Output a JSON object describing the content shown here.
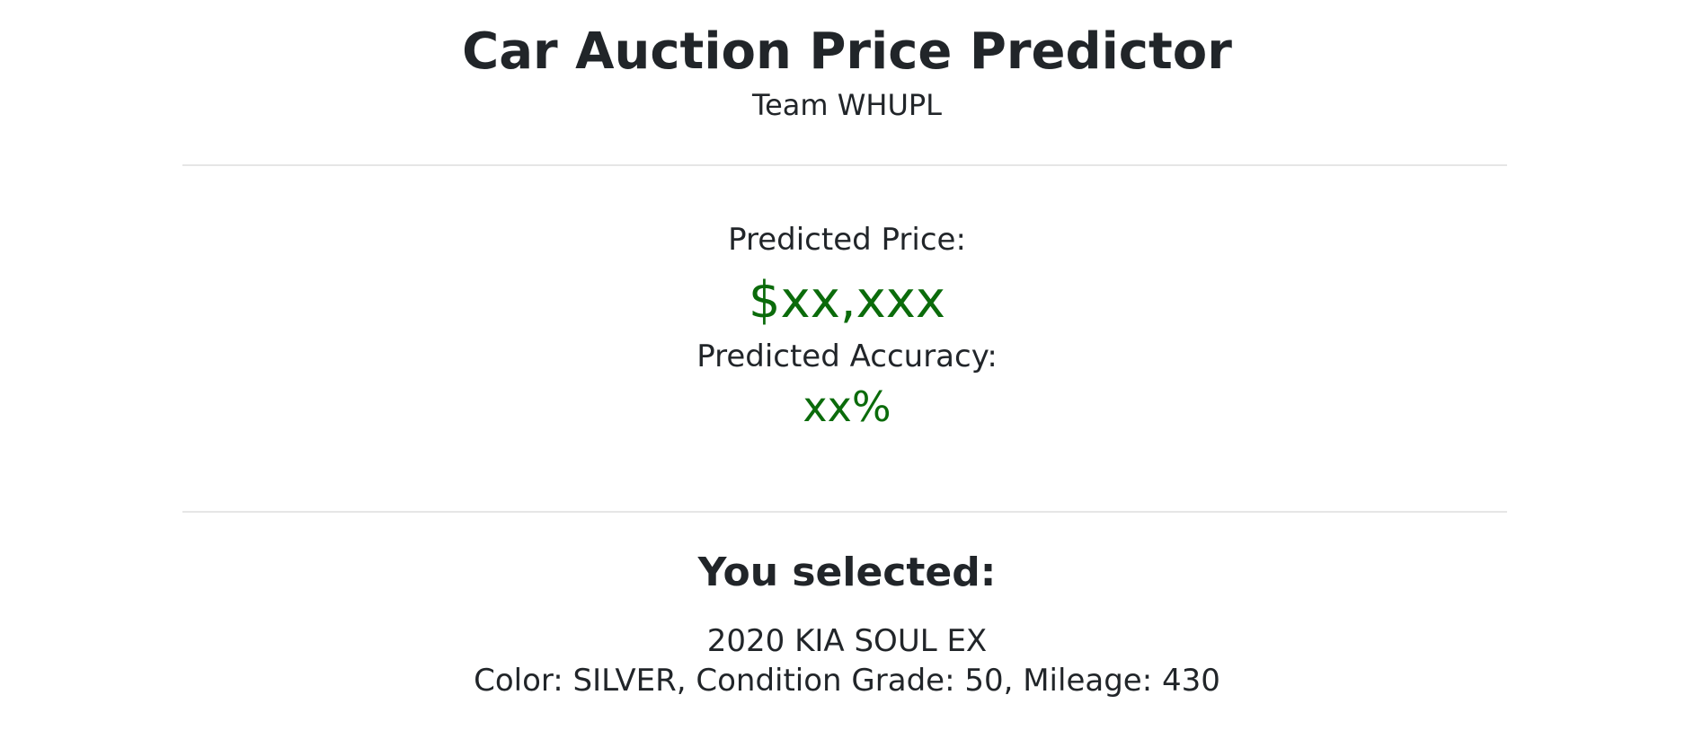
{
  "header": {
    "title": "Car Auction Price Predictor",
    "subtitle": "Team WHUPL"
  },
  "prediction": {
    "price_label": "Predicted Price:",
    "price_value": "$xx,xxx",
    "accuracy_label": "Predicted Accuracy:",
    "accuracy_value": "xx%"
  },
  "selection": {
    "heading": "You selected:",
    "car": "2020 KIA SOUL EX",
    "details": "Color: SILVER, Condition Grade: 50, Mileage: 430"
  },
  "colors": {
    "text": "#212529",
    "accent_green": "#0b6b0b",
    "divider": "#e6e6e6",
    "background": "#ffffff"
  }
}
